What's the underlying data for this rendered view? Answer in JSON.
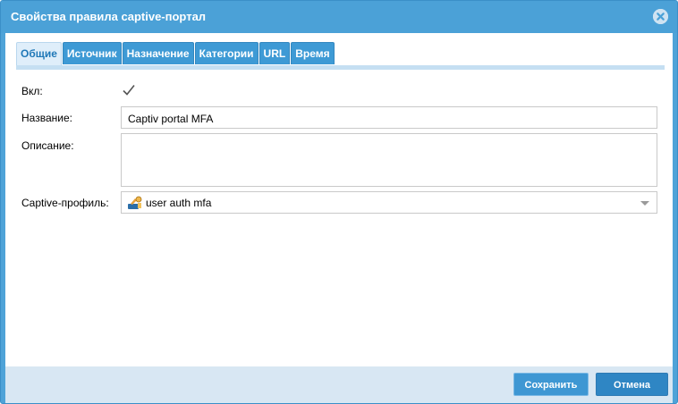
{
  "dialog": {
    "title": "Свойства правила captive-портал",
    "close_icon": "close-circle-icon"
  },
  "tabs": [
    {
      "label": "Общие",
      "active": true
    },
    {
      "label": "Источник",
      "active": false
    },
    {
      "label": "Назначение",
      "active": false
    },
    {
      "label": "Категории",
      "active": false
    },
    {
      "label": "URL",
      "active": false
    },
    {
      "label": "Время",
      "active": false
    }
  ],
  "form": {
    "enabled_label": "Вкл:",
    "enabled_checked": true,
    "name_label": "Название:",
    "name_value": "Captiv portal MFA",
    "description_label": "Описание:",
    "description_value": "",
    "profile_label": "Captive-профиль:",
    "profile_value": "user auth mfa",
    "profile_icon": "captive-profile-icon"
  },
  "footer": {
    "save_label": "Сохранить",
    "cancel_label": "Отмена"
  },
  "colors": {
    "title_bar": "#4ba1d7",
    "tab": "#3e9ad5",
    "footer": "#d8e7f3",
    "button": "#3a8fcb"
  }
}
